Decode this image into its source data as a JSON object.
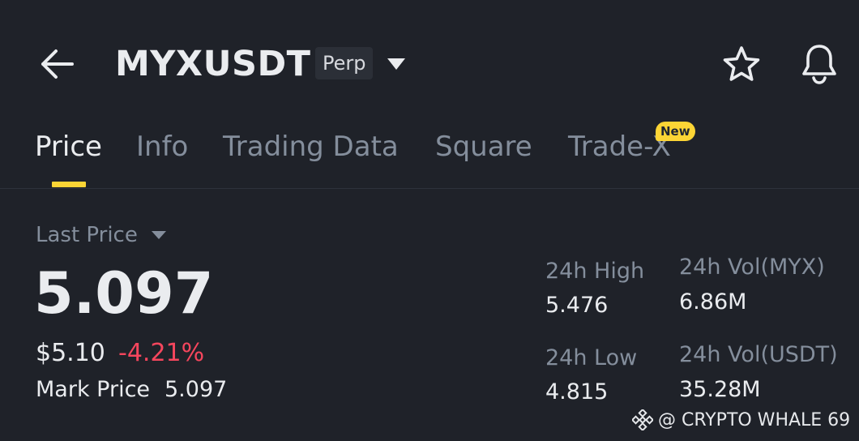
{
  "header": {
    "symbol": "MYXUSDT",
    "contract_type": "Perp"
  },
  "tabs": [
    {
      "label": "Price",
      "active": true
    },
    {
      "label": "Info",
      "active": false
    },
    {
      "label": "Trading Data",
      "active": false
    },
    {
      "label": "Square",
      "active": false
    },
    {
      "label": "Trade-X",
      "active": false,
      "badge": "New"
    }
  ],
  "price": {
    "last_price_label": "Last Price",
    "last_price": "5.097",
    "usd_price": "$5.10",
    "change_pct": "-4.21%",
    "mark_price_label": "Mark Price",
    "mark_price": "5.097"
  },
  "stats": {
    "high_label": "24h High",
    "high_value": "5.476",
    "low_label": "24h Low",
    "low_value": "4.815",
    "vol_base_label": "24h Vol(MYX)",
    "vol_base_value": "6.86M",
    "vol_quote_label": "24h Vol(USDT)",
    "vol_quote_value": "35.28M"
  },
  "watermark": {
    "text": "@ CRYPTO WHALE 69"
  },
  "icons": {
    "back": "arrow-left-icon",
    "dropdown": "caret-down-icon",
    "favorite": "star-icon",
    "alert": "bell-icon",
    "watermark_logo": "binance-logo-icon"
  },
  "colors": {
    "background": "#1f2229",
    "accent": "#fcd535",
    "negative": "#f6465d",
    "text_primary": "#eaecef",
    "text_secondary": "#848e9c"
  }
}
